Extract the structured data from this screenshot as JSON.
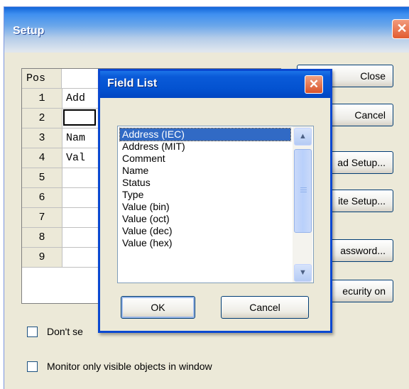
{
  "setup": {
    "title": "Setup",
    "close_glyph": "✕",
    "grid": {
      "header": "Pos",
      "rows": [
        {
          "pos": "1",
          "value": "Add"
        },
        {
          "pos": "2",
          "value": ""
        },
        {
          "pos": "3",
          "value": "Nam"
        },
        {
          "pos": "4",
          "value": "Val"
        },
        {
          "pos": "5",
          "value": ""
        },
        {
          "pos": "6",
          "value": ""
        },
        {
          "pos": "7",
          "value": ""
        },
        {
          "pos": "8",
          "value": ""
        },
        {
          "pos": "9",
          "value": ""
        }
      ]
    },
    "buttons": {
      "close": "Close",
      "cancel": "Cancel",
      "load_setup": "ad Setup...",
      "write_setup": "ite Setup...",
      "password": "assword...",
      "security_on": "ecurity on"
    },
    "checkboxes": {
      "dont_search": "Don't se",
      "monitor_visible": "Monitor only visible objects in window"
    }
  },
  "field_list": {
    "title": "Field List",
    "close_glyph": "✕",
    "items": [
      "Address (IEC)",
      "Address (MIT)",
      "Comment",
      "Name",
      "Status",
      "Type",
      "Value (bin)",
      "Value (oct)",
      "Value (dec)",
      "Value (hex)"
    ],
    "selected_index": 0,
    "ok_label": "OK",
    "cancel_label": "Cancel"
  },
  "icons": {
    "scroll_up": "▲",
    "scroll_down": "▼"
  }
}
